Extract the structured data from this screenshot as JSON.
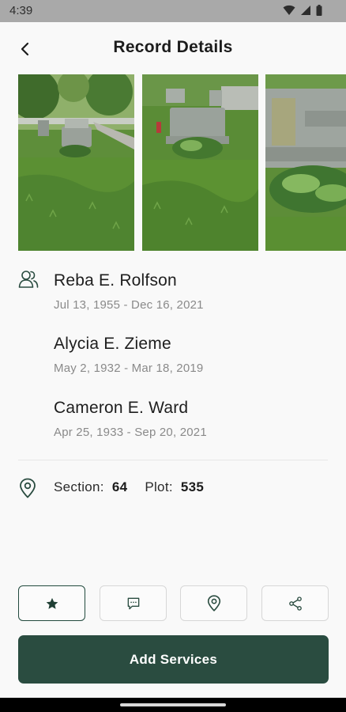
{
  "status_bar": {
    "time": "4:39"
  },
  "header": {
    "title": "Record Details"
  },
  "gallery": {
    "photos": [
      {
        "label": "grave-photo-1"
      },
      {
        "label": "grave-photo-2"
      },
      {
        "label": "grave-photo-3"
      }
    ]
  },
  "records": [
    {
      "name": "Reba E. Rolfson",
      "dates": "Jul 13, 1955 - Dec 16, 2021"
    },
    {
      "name": "Alycia E. Zieme",
      "dates": "May 2, 1932 - Mar 18, 2019"
    },
    {
      "name": "Cameron E. Ward",
      "dates": "Apr 25, 1933 - Sep 20, 2021"
    }
  ],
  "location": {
    "section_label": "Section:",
    "section_value": "64",
    "plot_label": "Plot:",
    "plot_value": "535"
  },
  "actions": {
    "favorite_icon": "star-icon",
    "message_icon": "chat-icon",
    "map_icon": "map-pin-icon",
    "share_icon": "share-icon"
  },
  "primary_action": {
    "label": "Add Services"
  },
  "colors": {
    "brand": "#2a4c40",
    "muted_text": "#8a8a8a",
    "status_bar": "#a9a9a9"
  }
}
